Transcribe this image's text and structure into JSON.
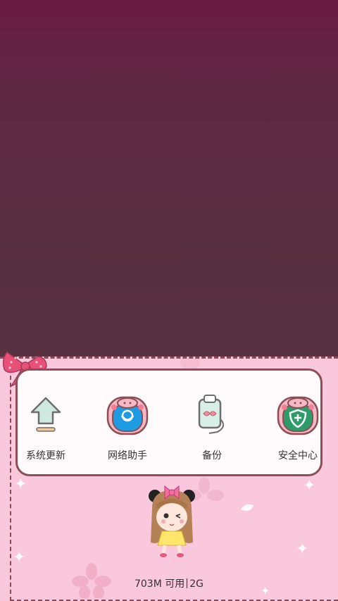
{
  "shortcuts": [
    {
      "label": "系统更新",
      "icon": "upload-arrow-icon"
    },
    {
      "label": "网络助手",
      "icon": "pig-network-icon"
    },
    {
      "label": "备份",
      "icon": "backup-card-icon"
    },
    {
      "label": "安全中心",
      "icon": "pig-shield-icon"
    }
  ],
  "storage": {
    "free": "703M 可用",
    "total": "2G"
  },
  "colors": {
    "panel": "#f9c8dd",
    "card_border": "#8b4f55",
    "network_blue": "#1e9be2",
    "security_green": "#2e9c6a"
  }
}
